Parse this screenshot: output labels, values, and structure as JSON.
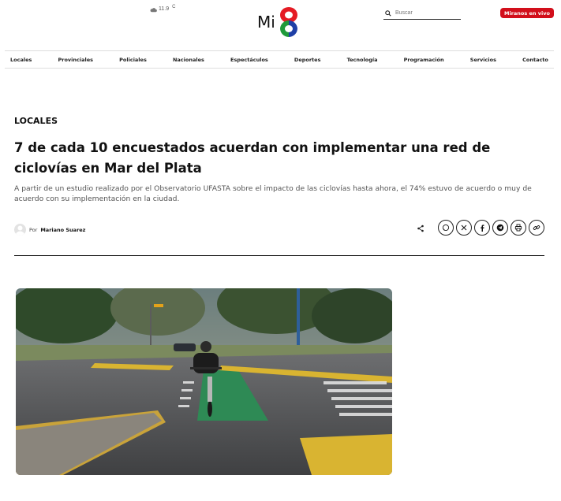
{
  "header": {
    "weather_temp": "11.9",
    "weather_unit": "C",
    "logo_text": "Mi",
    "search_placeholder": "Buscar",
    "live_button": "Miranos en vivo"
  },
  "nav": {
    "items": [
      "Locales",
      "Provinciales",
      "Policiales",
      "Nacionales",
      "Espectáculos",
      "Deportes",
      "Tecnología",
      "Programación",
      "Servicios",
      "Contacto"
    ]
  },
  "article": {
    "category": "LOCALES",
    "headline": "7 de cada 10 encuestados acuerdan con implementar una red de ciclovías en Mar del Plata",
    "subtitle": "A partir de un estudio realizado por el Observatorio UFASTA sobre el impacto de las ciclovías hasta ahora, el 74% estuvo de acuerdo o muy de acuerdo con su implementación en la ciudad.",
    "by_prefix": "Por",
    "author": "Mariano Suarez"
  },
  "share": {
    "icons": [
      "whatsapp-icon",
      "x-icon",
      "facebook-icon",
      "telegram-icon",
      "print-icon",
      "link-icon"
    ]
  },
  "colors": {
    "live_red": "#d20f1b",
    "text": "#111111"
  }
}
